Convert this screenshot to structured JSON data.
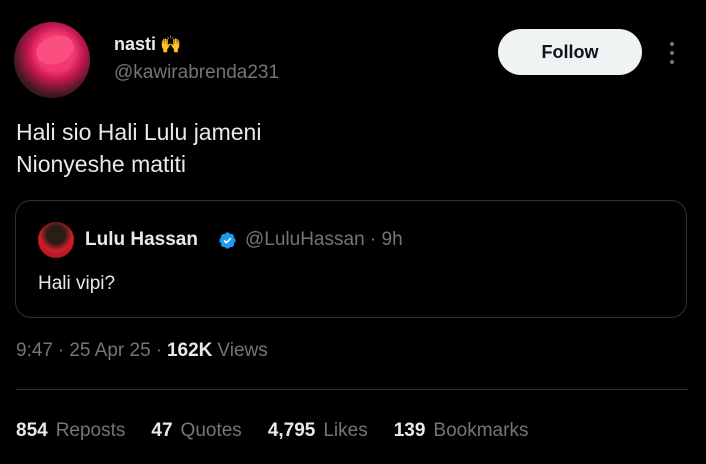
{
  "author": {
    "name": "nasti",
    "emoji": "🙌",
    "handle": "@kawirabrenda231"
  },
  "follow_label": "Follow",
  "post_text": [
    "Hali sio Hali Lulu jameni",
    "Nionyeshe matiti"
  ],
  "quoted": {
    "name": "Lulu Hassan",
    "handle": "@LuluHassan · 9h",
    "text": "Hali vipi?",
    "verified_color": "#1d9bf0"
  },
  "meta": {
    "time": "9:47",
    "date": "25 Apr 25",
    "views_count": "162K",
    "views_label": "Views",
    "sep": "·"
  },
  "stats": [
    {
      "count": "854",
      "label": "Reposts"
    },
    {
      "count": "47",
      "label": "Quotes"
    },
    {
      "count": "4,795",
      "label": "Likes"
    },
    {
      "count": "139",
      "label": "Bookmarks"
    }
  ]
}
